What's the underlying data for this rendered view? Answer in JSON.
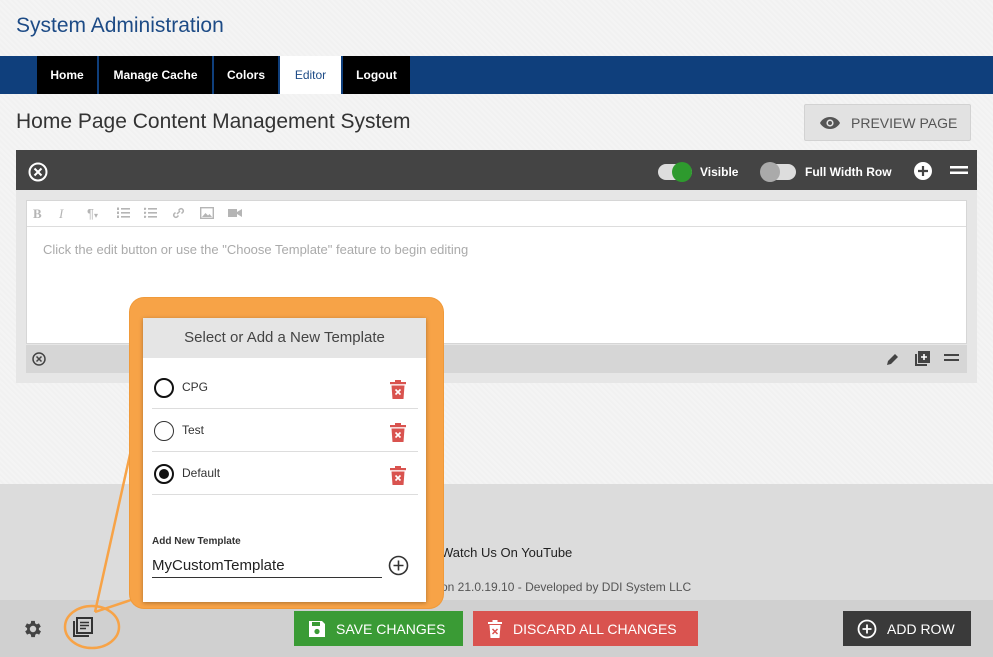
{
  "header": {
    "title": "System Administration"
  },
  "nav": {
    "items": [
      {
        "label": "Home"
      },
      {
        "label": "Manage Cache"
      },
      {
        "label": "Colors"
      },
      {
        "label": "Editor"
      },
      {
        "label": "Logout"
      }
    ],
    "active": "Editor"
  },
  "page": {
    "title": "Home Page Content Management System",
    "preview_label": "PREVIEW PAGE"
  },
  "row_toolbar": {
    "visible_label": "Visible",
    "visible_on": true,
    "full_width_label": "Full Width Row",
    "full_width_on": false
  },
  "editor": {
    "toolbar_icons": [
      "bold-icon",
      "italic-icon",
      "paragraph-icon",
      "ordered-list-icon",
      "bullet-list-icon",
      "link-icon",
      "image-icon",
      "video-icon"
    ],
    "placeholder": "Click the edit button or use the \"Choose Template\" feature to begin editing"
  },
  "template_popup": {
    "title": "Select or Add a New Template",
    "templates": [
      {
        "name": "CPG",
        "selected": false
      },
      {
        "name": "Test",
        "selected": false
      },
      {
        "name": "Default",
        "selected": true
      }
    ],
    "add_label": "Add New Template",
    "add_value": "MyCustomTemplate"
  },
  "footer": {
    "youtube": "Watch Us On YouTube",
    "version": "on 21.0.19.10 - Developed by DDI System LLC"
  },
  "bottom_bar": {
    "save_label": "SAVE CHANGES",
    "discard_label": "DISCARD ALL CHANGES",
    "add_row_label": "ADD ROW"
  },
  "colors": {
    "nav_bg": "#0f3f7c",
    "save": "#3a9b35",
    "discard": "#d9534f",
    "toggle_on": "#2e9a2e",
    "highlight": "#f7a347"
  }
}
